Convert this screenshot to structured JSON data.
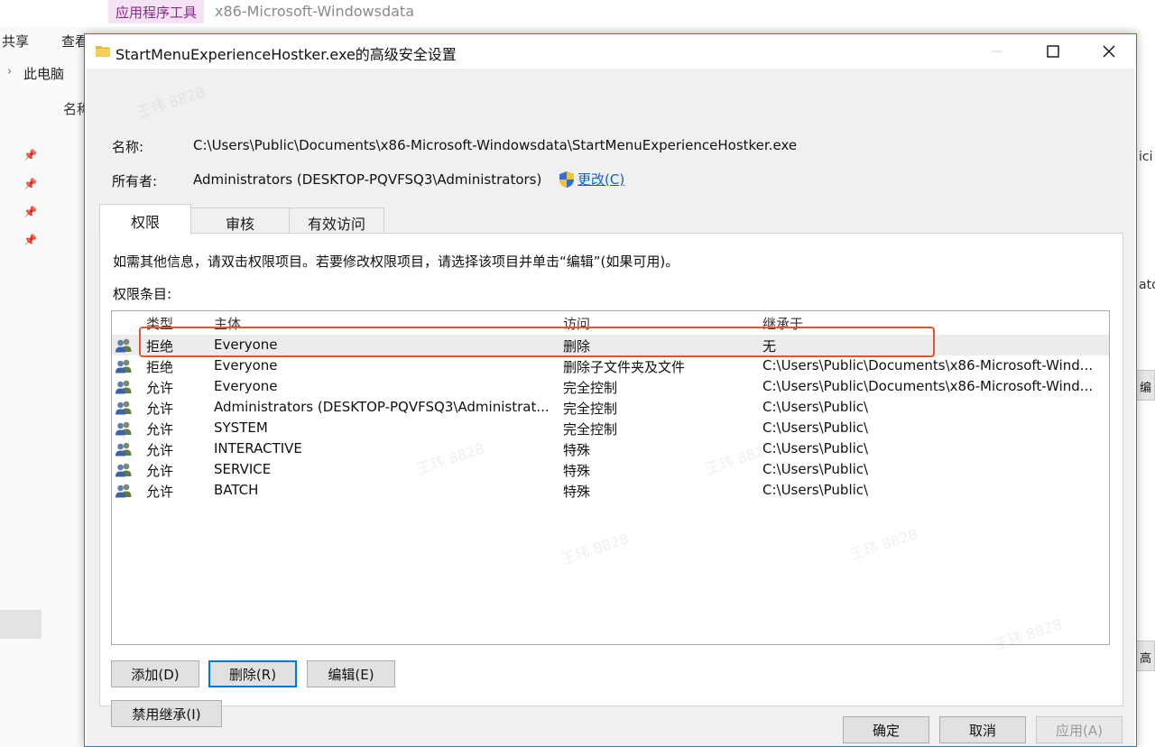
{
  "explorer": {
    "tool_tab": "应用程序工具",
    "folder_title": "x86-Microsoft-Windowsdata",
    "ribbon": {
      "share": "共享",
      "view": "查看"
    },
    "breadcrumb": "此电脑",
    "column_header": "名称"
  },
  "dialog": {
    "title": "StartMenuExperienceHostker.exe的高级安全设置",
    "name_label": "名称:",
    "name_value": "C:\\Users\\Public\\Documents\\x86-Microsoft-Windowsdata\\StartMenuExperienceHostker.exe",
    "owner_label": "所有者:",
    "owner_value": "Administrators (DESKTOP-PQVFSQ3\\Administrators)",
    "change_link": "更改(C)",
    "tabs": [
      "权限",
      "审核",
      "有效访问"
    ],
    "info_text": "如需其他信息，请双击权限项目。若要修改权限项目，请选择该项目并单击“编辑”(如果可用)。",
    "entries_label": "权限条目:",
    "columns": {
      "type": "类型",
      "principal": "主体",
      "access": "访问",
      "inherited": "继承于"
    },
    "entries": [
      {
        "type": "拒绝",
        "principal": "Everyone",
        "access": "删除",
        "inherited": "无"
      },
      {
        "type": "拒绝",
        "principal": "Everyone",
        "access": "删除子文件夹及文件",
        "inherited": "C:\\Users\\Public\\Documents\\x86-Microsoft-Wind..."
      },
      {
        "type": "允许",
        "principal": "Everyone",
        "access": "完全控制",
        "inherited": "C:\\Users\\Public\\Documents\\x86-Microsoft-Wind..."
      },
      {
        "type": "允许",
        "principal": "Administrators (DESKTOP-PQVFSQ3\\Administrat...",
        "access": "完全控制",
        "inherited": "C:\\Users\\Public\\"
      },
      {
        "type": "允许",
        "principal": "SYSTEM",
        "access": "完全控制",
        "inherited": "C:\\Users\\Public\\"
      },
      {
        "type": "允许",
        "principal": "INTERACTIVE",
        "access": "特殊",
        "inherited": "C:\\Users\\Public\\"
      },
      {
        "type": "允许",
        "principal": "SERVICE",
        "access": "特殊",
        "inherited": "C:\\Users\\Public\\"
      },
      {
        "type": "允许",
        "principal": "BATCH",
        "access": "特殊",
        "inherited": "C:\\Users\\Public\\"
      }
    ],
    "buttons": {
      "add": "添加(D)",
      "remove": "删除(R)",
      "edit": "编辑(E)",
      "disable_inheritance": "禁用继承(I)",
      "ok": "确定",
      "cancel": "取消",
      "apply": "应用(A)"
    }
  },
  "watermark": "王玮 8828",
  "colors": {
    "highlight": "#e4572e",
    "link": "#1a5fbd",
    "accent": "#0078d7"
  }
}
